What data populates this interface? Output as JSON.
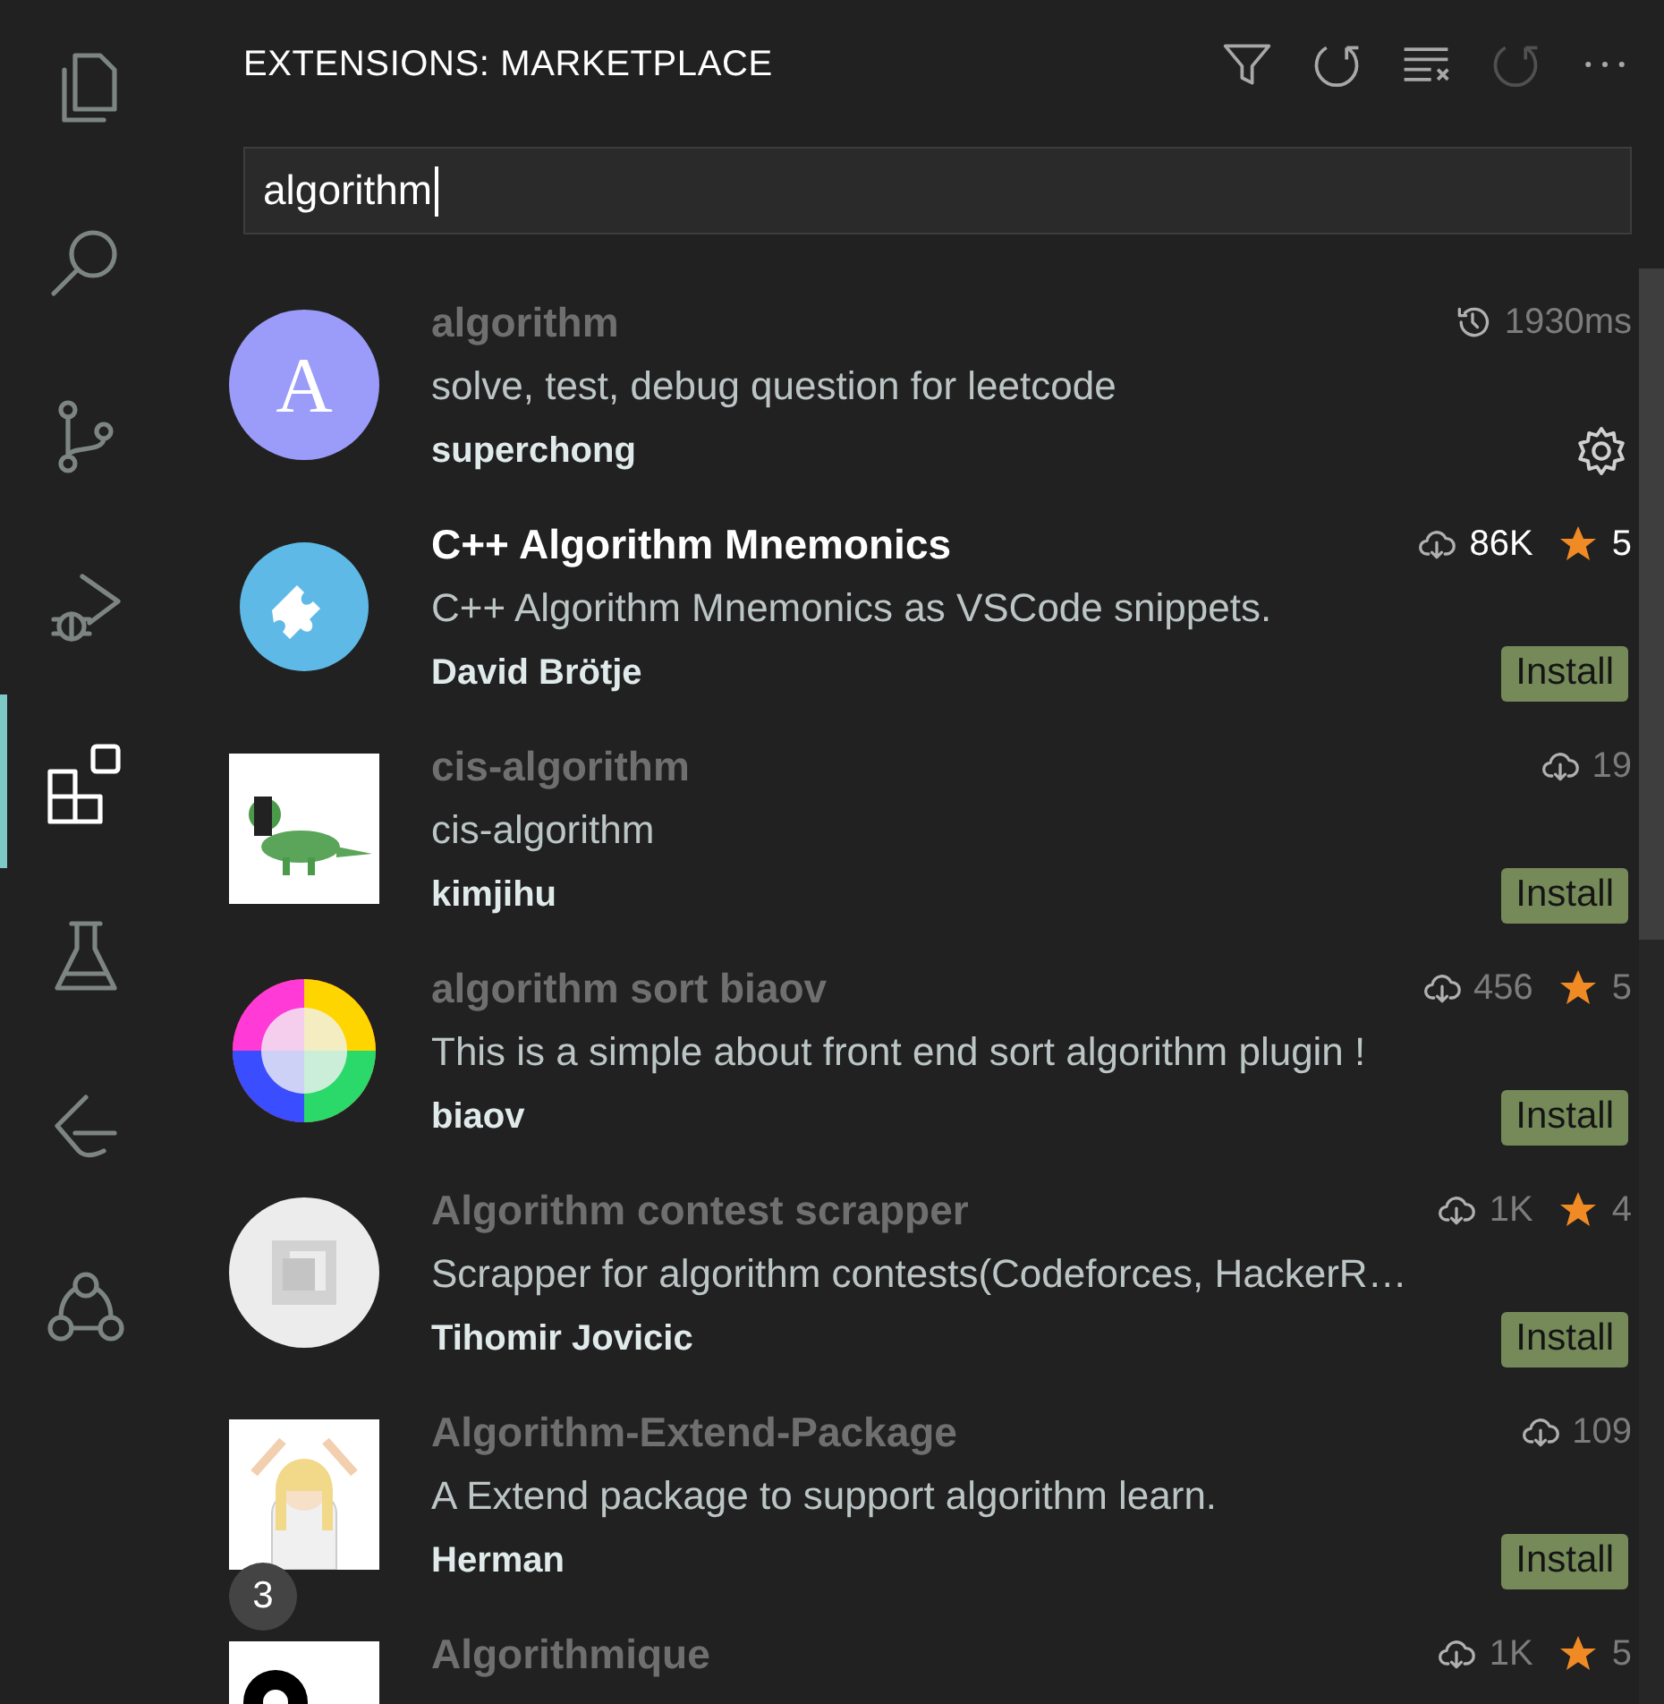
{
  "activity_bar": [
    {
      "selected": false
    },
    {
      "selected": false
    },
    {
      "selected": false
    },
    {
      "selected": false
    },
    {
      "selected": true
    },
    {
      "selected": false
    },
    {
      "selected": false
    },
    {
      "selected": false
    }
  ],
  "panel": {
    "title": "EXTENSIONS: MARKETPLACE",
    "actions": [
      {
        "disabled": false
      },
      {
        "disabled": false
      },
      {
        "disabled": false
      },
      {
        "disabled": true
      },
      {
        "disabled": false
      }
    ]
  },
  "search": {
    "value": "algorithm"
  },
  "extensions": [
    {
      "kind": "installed",
      "icon": {
        "kind": "letter",
        "letter": "A"
      },
      "name": "algorithm",
      "dimmed": true,
      "time": "1930ms",
      "description": "solve, test, debug question for leetcode",
      "author": "superchong"
    },
    {
      "kind": "marketplace",
      "icon": {
        "kind": "puzzle"
      },
      "name": "C++ Algorithm Mnemonics",
      "dimmed": false,
      "downloads": "86K",
      "rating": "5",
      "description": "C++ Algorithm Mnemonics as VSCode snippets.",
      "author": "David Brötje",
      "button": "Install"
    },
    {
      "kind": "marketplace",
      "name": "cis-algorithm",
      "dimmed": true,
      "downloads": "19",
      "description": "cis-algorithm",
      "author": "kimjihu",
      "button": "Install"
    },
    {
      "kind": "marketplace",
      "name": "algorithm sort biaov",
      "dimmed": true,
      "downloads": "456",
      "rating": "5",
      "description": "This is a simple about front end sort algorithm plugin !",
      "author": "biaov",
      "button": "Install"
    },
    {
      "kind": "marketplace",
      "icon": {
        "kind": "cube"
      },
      "name": "Algorithm contest scrapper",
      "dimmed": true,
      "downloads": "1K",
      "rating": "4",
      "description": "Scrapper for algorithm contests(Codeforces, HackerR…",
      "author": "Tihomir Jovicic",
      "button": "Install"
    },
    {
      "kind": "marketplace",
      "badge": "3",
      "name": "Algorithm-Extend-Package",
      "dimmed": true,
      "downloads": "109",
      "description": "A Extend package to support algorithm learn.",
      "author": "Herman",
      "button": "Install"
    },
    {
      "kind": "marketplace",
      "icon": {
        "kind": "gears"
      },
      "name": "Algorithmique",
      "dimmed": true,
      "downloads": "1K",
      "rating": "5"
    }
  ]
}
